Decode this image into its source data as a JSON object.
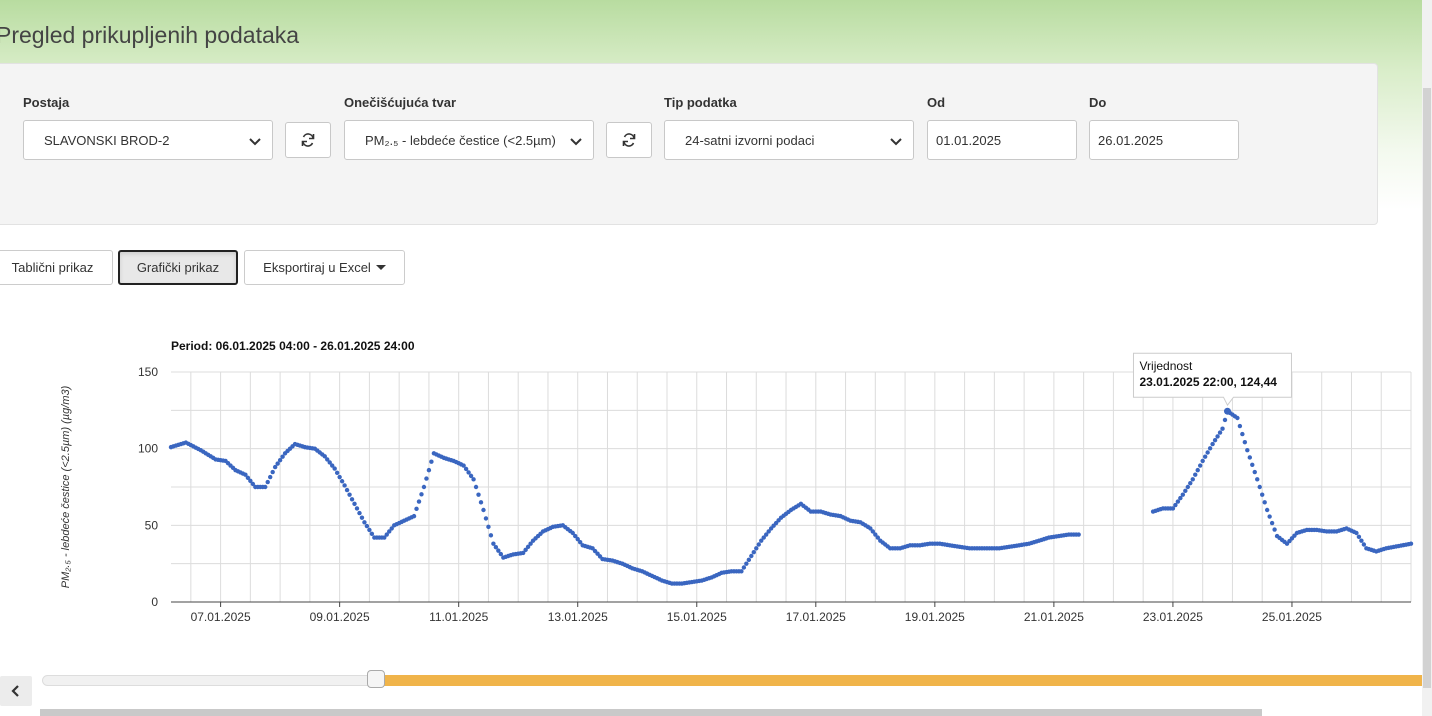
{
  "page": {
    "title": "Pregled prikupljenih podataka"
  },
  "filters": {
    "station": {
      "label": "Postaja",
      "value": "SLAVONSKI BROD-2"
    },
    "pollutant": {
      "label": "Onečišćujuća tvar",
      "value": "PM₂.₅ - lebdeće čestice (<2.5µm)"
    },
    "data_type": {
      "label": "Tip podatka",
      "value": "24-satni izvorni podaci"
    },
    "from": {
      "label": "Od",
      "value": "01.01.2025"
    },
    "to": {
      "label": "Do",
      "value": "26.01.2025"
    }
  },
  "view_buttons": {
    "table": "Tablični prikaz",
    "chart": "Grafički prikaz",
    "export": "Eksportiraj u Excel"
  },
  "icons": {
    "refresh": "refresh-icon",
    "chevron": "chevron-down-icon",
    "scroll_left": "chevron-left-icon"
  },
  "colors": {
    "series": "#3a66c0",
    "range_fill": "#f0b44a",
    "tooltip_border": "#cccccc"
  },
  "chart_data": {
    "type": "scatter",
    "title": "Period: 06.01.2025 04:00 - 26.01.2025 24:00",
    "xlabel": "",
    "ylabel": "PM₂.₅ - lebdeće čestice (<2.5µm) (µg/m3)",
    "ylim": [
      0,
      150
    ],
    "xlim": [
      "06.01.2025 04:00",
      "26.01.2025 24:00"
    ],
    "yticks": [
      0,
      50,
      100,
      150
    ],
    "xticks": [
      "07.01.2025",
      "09.01.2025",
      "11.01.2025",
      "13.01.2025",
      "15.01.2025",
      "17.01.2025",
      "19.01.2025",
      "21.01.2025",
      "23.01.2025",
      "25.01.2025"
    ],
    "grid": true,
    "series": [
      {
        "values": [
          [
            "06.01.2025 04:00",
            101
          ],
          [
            "06.01.2025 10:00",
            104
          ],
          [
            "06.01.2025 16:00",
            99
          ],
          [
            "06.01.2025 22:00",
            93
          ],
          [
            "07.01.2025 02:00",
            92
          ],
          [
            "07.01.2025 06:00",
            86
          ],
          [
            "07.01.2025 10:00",
            83
          ],
          [
            "07.01.2025 14:00",
            75
          ],
          [
            "07.01.2025 18:00",
            75
          ],
          [
            "07.01.2025 22:00",
            88
          ],
          [
            "08.01.2025 02:00",
            97
          ],
          [
            "08.01.2025 06:00",
            103
          ],
          [
            "08.01.2025 10:00",
            101
          ],
          [
            "08.01.2025 14:00",
            100
          ],
          [
            "08.01.2025 18:00",
            95
          ],
          [
            "08.01.2025 22:00",
            87
          ],
          [
            "09.01.2025 02:00",
            76
          ],
          [
            "09.01.2025 06:00",
            64
          ],
          [
            "09.01.2025 10:00",
            52
          ],
          [
            "09.01.2025 14:00",
            42
          ],
          [
            "09.01.2025 18:00",
            42
          ],
          [
            "09.01.2025 22:00",
            50
          ],
          [
            "10.01.2025 02:00",
            53
          ],
          [
            "10.01.2025 06:00",
            56
          ],
          [
            "10.01.2025 10:00",
            75
          ],
          [
            "10.01.2025 14:00",
            97
          ],
          [
            "10.01.2025 18:00",
            94
          ],
          [
            "10.01.2025 22:00",
            92
          ],
          [
            "11.01.2025 02:00",
            89
          ],
          [
            "11.01.2025 06:00",
            80
          ],
          [
            "11.01.2025 10:00",
            60
          ],
          [
            "11.01.2025 14:00",
            38
          ],
          [
            "11.01.2025 18:00",
            29
          ],
          [
            "11.01.2025 22:00",
            31
          ],
          [
            "12.01.2025 02:00",
            32
          ],
          [
            "12.01.2025 06:00",
            40
          ],
          [
            "12.01.2025 10:00",
            46
          ],
          [
            "12.01.2025 14:00",
            49
          ],
          [
            "12.01.2025 18:00",
            50
          ],
          [
            "12.01.2025 22:00",
            45
          ],
          [
            "13.01.2025 02:00",
            37
          ],
          [
            "13.01.2025 06:00",
            35
          ],
          [
            "13.01.2025 10:00",
            28
          ],
          [
            "13.01.2025 14:00",
            27
          ],
          [
            "13.01.2025 18:00",
            25
          ],
          [
            "13.01.2025 22:00",
            22
          ],
          [
            "14.01.2025 02:00",
            20
          ],
          [
            "14.01.2025 06:00",
            17
          ],
          [
            "14.01.2025 10:00",
            14
          ],
          [
            "14.01.2025 14:00",
            12
          ],
          [
            "14.01.2025 18:00",
            12
          ],
          [
            "14.01.2025 22:00",
            13
          ],
          [
            "15.01.2025 02:00",
            14
          ],
          [
            "15.01.2025 06:00",
            16
          ],
          [
            "15.01.2025 10:00",
            19
          ],
          [
            "15.01.2025 14:00",
            20
          ],
          [
            "15.01.2025 18:00",
            20
          ],
          [
            "15.01.2025 22:00",
            30
          ],
          [
            "16.01.2025 02:00",
            40
          ],
          [
            "16.01.2025 06:00",
            48
          ],
          [
            "16.01.2025 10:00",
            55
          ],
          [
            "16.01.2025 14:00",
            60
          ],
          [
            "16.01.2025 18:00",
            64
          ],
          [
            "16.01.2025 22:00",
            59
          ],
          [
            "17.01.2025 02:00",
            59
          ],
          [
            "17.01.2025 06:00",
            57
          ],
          [
            "17.01.2025 10:00",
            56
          ],
          [
            "17.01.2025 14:00",
            53
          ],
          [
            "17.01.2025 18:00",
            52
          ],
          [
            "17.01.2025 22:00",
            48
          ],
          [
            "18.01.2025 02:00",
            40
          ],
          [
            "18.01.2025 06:00",
            35
          ],
          [
            "18.01.2025 10:00",
            35
          ],
          [
            "18.01.2025 14:00",
            37
          ],
          [
            "18.01.2025 18:00",
            37
          ],
          [
            "18.01.2025 22:00",
            38
          ],
          [
            "19.01.2025 02:00",
            38
          ],
          [
            "19.01.2025 06:00",
            37
          ],
          [
            "19.01.2025 10:00",
            36
          ],
          [
            "19.01.2025 14:00",
            35
          ],
          [
            "19.01.2025 18:00",
            35
          ],
          [
            "19.01.2025 22:00",
            35
          ],
          [
            "20.01.2025 02:00",
            35
          ],
          [
            "20.01.2025 06:00",
            36
          ],
          [
            "20.01.2025 10:00",
            37
          ],
          [
            "20.01.2025 14:00",
            38
          ],
          [
            "20.01.2025 18:00",
            40
          ],
          [
            "20.01.2025 22:00",
            42
          ],
          [
            "21.01.2025 02:00",
            43
          ],
          [
            "21.01.2025 06:00",
            44
          ],
          [
            "21.01.2025 10:00",
            44
          ]
        ]
      },
      {
        "values": [
          [
            "22.01.2025 16:00",
            59
          ],
          [
            "22.01.2025 20:00",
            61
          ],
          [
            "23.01.2025 00:00",
            61
          ],
          [
            "23.01.2025 04:00",
            70
          ],
          [
            "23.01.2025 08:00",
            80
          ],
          [
            "23.01.2025 12:00",
            92
          ],
          [
            "23.01.2025 16:00",
            103
          ],
          [
            "23.01.2025 20:00",
            113
          ],
          [
            "23.01.2025 22:00",
            124.44
          ],
          [
            "24.01.2025 02:00",
            120
          ],
          [
            "24.01.2025 06:00",
            99
          ],
          [
            "24.01.2025 10:00",
            80
          ],
          [
            "24.01.2025 14:00",
            60
          ],
          [
            "24.01.2025 18:00",
            43
          ],
          [
            "24.01.2025 22:00",
            38
          ],
          [
            "25.01.2025 02:00",
            45
          ],
          [
            "25.01.2025 06:00",
            47
          ],
          [
            "25.01.2025 10:00",
            47
          ],
          [
            "25.01.2025 14:00",
            46
          ],
          [
            "25.01.2025 18:00",
            46
          ],
          [
            "25.01.2025 22:00",
            48
          ],
          [
            "26.01.2025 02:00",
            45
          ],
          [
            "26.01.2025 06:00",
            35
          ],
          [
            "26.01.2025 10:00",
            33
          ],
          [
            "26.01.2025 14:00",
            35
          ],
          [
            "26.01.2025 24:00",
            38
          ]
        ]
      }
    ],
    "tooltip": {
      "title": "Vrijednost",
      "x": "23.01.2025 22:00",
      "y": 124.44,
      "value_text": "23.01.2025 22:00, 124,44"
    }
  },
  "range_slider": {
    "selected_start_fraction": 0.24,
    "selected_end_fraction": 1.0
  }
}
